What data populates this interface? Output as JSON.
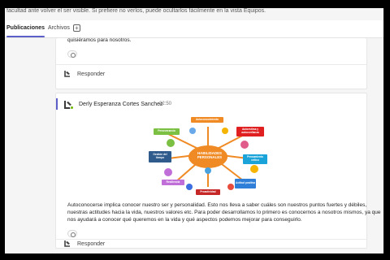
{
  "top_cut_text": "facultad ante volver el ser visible. Si prefiere no verlos, puede ocultarlos fácilmente en la vista Equipos.",
  "tabs": {
    "publicaciones": "Publicaciones",
    "archivos": "Archivos"
  },
  "post1": {
    "text_tail": "quisiéramos para nosotros.",
    "reply_label": "Responder"
  },
  "post2": {
    "author": "Derly Esperanza Cortes Sanchez",
    "time": "22:50",
    "diagram": {
      "center": "HABILIDADES PERSONALES",
      "boxes": {
        "autoconocimiento": "Autoconocimiento",
        "perseverancia": "Perseverancia",
        "autoestima": "Autoestima y autoconfianza",
        "gestion": "Gestión del tiempo",
        "pensamiento": "Pensamiento crítico",
        "resiliencia": "Resiliencia",
        "actitud": "Actitud positiva",
        "proactividad": "Proactividad"
      }
    },
    "text_lines": [
      "Autoconocerse implica conocer nuestro ser y personalidad. Esto nos lleva a saber cuáles son nuestros puntos fuertes y débiles,",
      "nuestras actitudes hacia la vida, nuestros valores etc. Para poder desarrollarnos lo primero es conocernos a nosotros mismos, ya que",
      "nos ayudará a conocer qué queremos en la vida y qué aspectos podemos mejorar para conseguirlo."
    ],
    "reply_label": "Responder"
  },
  "colors": {
    "accent": "#5b5fc7",
    "center": "#f08a24",
    "presence": "#6bb700"
  },
  "icons": [
    "add-tab-icon",
    "reaction-icon",
    "reply-icon",
    "avatar-icon"
  ]
}
